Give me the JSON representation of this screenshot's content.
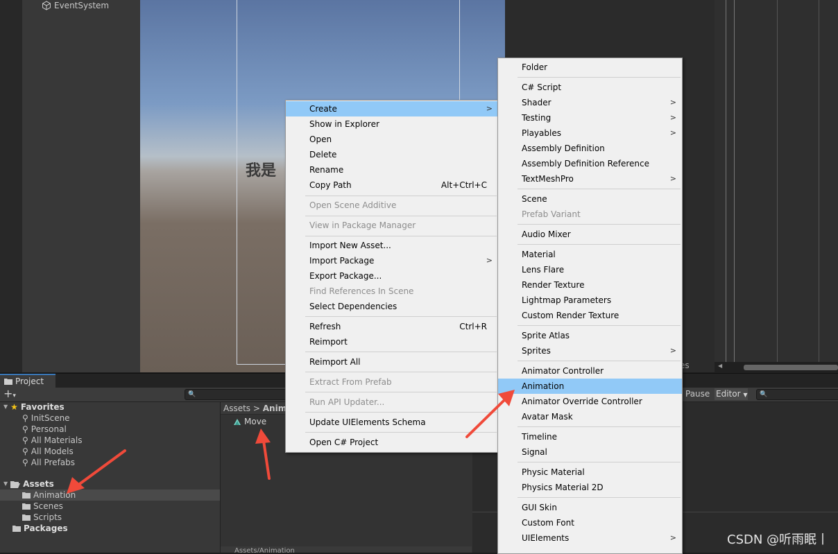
{
  "hierarchy": {
    "item": "EventSystem"
  },
  "scene": {
    "text": "我是"
  },
  "project": {
    "tab_label": "Project",
    "favorites_label": "Favorites",
    "favorites": [
      "InitScene",
      "Personal",
      "All Materials",
      "All Models",
      "All Prefabs"
    ],
    "assets_label": "Assets",
    "assets_children": [
      "Animation",
      "Scenes",
      "Scripts"
    ],
    "packages_label": "Packages",
    "breadcrumb_root": "Assets",
    "breadcrumb_current": "Anima",
    "asset_item": "Move",
    "footer_path": "Assets/Animation"
  },
  "animation_window": {
    "curves_label": "rves",
    "pause_label": "Pause",
    "editor_label": "Editor"
  },
  "context_menu": {
    "items": [
      {
        "label": "Create",
        "arrow": true,
        "highlight": true
      },
      {
        "label": "Show in Explorer"
      },
      {
        "label": "Open"
      },
      {
        "label": "Delete"
      },
      {
        "label": "Rename"
      },
      {
        "label": "Copy Path",
        "shortcut": "Alt+Ctrl+C"
      },
      {
        "label": "Open Scene Additive",
        "disabled": true
      },
      {
        "label": "View in Package Manager",
        "disabled": true
      },
      {
        "label": "Import New Asset..."
      },
      {
        "label": "Import Package",
        "arrow": true
      },
      {
        "label": "Export Package..."
      },
      {
        "label": "Find References In Scene",
        "disabled": true
      },
      {
        "label": "Select Dependencies"
      },
      {
        "label": "Refresh",
        "shortcut": "Ctrl+R"
      },
      {
        "label": "Reimport"
      },
      {
        "label": "Reimport All"
      },
      {
        "label": "Extract From Prefab",
        "disabled": true
      },
      {
        "label": "Run API Updater...",
        "disabled": true
      },
      {
        "label": "Update UIElements Schema"
      },
      {
        "label": "Open C# Project"
      }
    ]
  },
  "create_submenu": {
    "items": [
      {
        "label": "Folder"
      },
      {
        "label": "C# Script"
      },
      {
        "label": "Shader",
        "arrow": true
      },
      {
        "label": "Testing",
        "arrow": true
      },
      {
        "label": "Playables",
        "arrow": true
      },
      {
        "label": "Assembly Definition"
      },
      {
        "label": "Assembly Definition Reference"
      },
      {
        "label": "TextMeshPro",
        "arrow": true
      },
      {
        "label": "Scene"
      },
      {
        "label": "Prefab Variant",
        "disabled": true
      },
      {
        "label": "Audio Mixer"
      },
      {
        "label": "Material"
      },
      {
        "label": "Lens Flare"
      },
      {
        "label": "Render Texture"
      },
      {
        "label": "Lightmap Parameters"
      },
      {
        "label": "Custom Render Texture"
      },
      {
        "label": "Sprite Atlas"
      },
      {
        "label": "Sprites",
        "arrow": true
      },
      {
        "label": "Animator Controller"
      },
      {
        "label": "Animation",
        "highlight": true
      },
      {
        "label": "Animator Override Controller"
      },
      {
        "label": "Avatar Mask"
      },
      {
        "label": "Timeline"
      },
      {
        "label": "Signal"
      },
      {
        "label": "Physic Material"
      },
      {
        "label": "Physics Material 2D"
      },
      {
        "label": "GUI Skin"
      },
      {
        "label": "Custom Font"
      },
      {
        "label": "UIElements",
        "arrow": true
      }
    ]
  },
  "watermark": "CSDN @听雨眠丨",
  "colors": {
    "menu_highlight": "#91c9f7",
    "menu_background": "#f0f0f0",
    "annotation_arrow": "#f04a3a",
    "editor_dark": "#383838"
  }
}
